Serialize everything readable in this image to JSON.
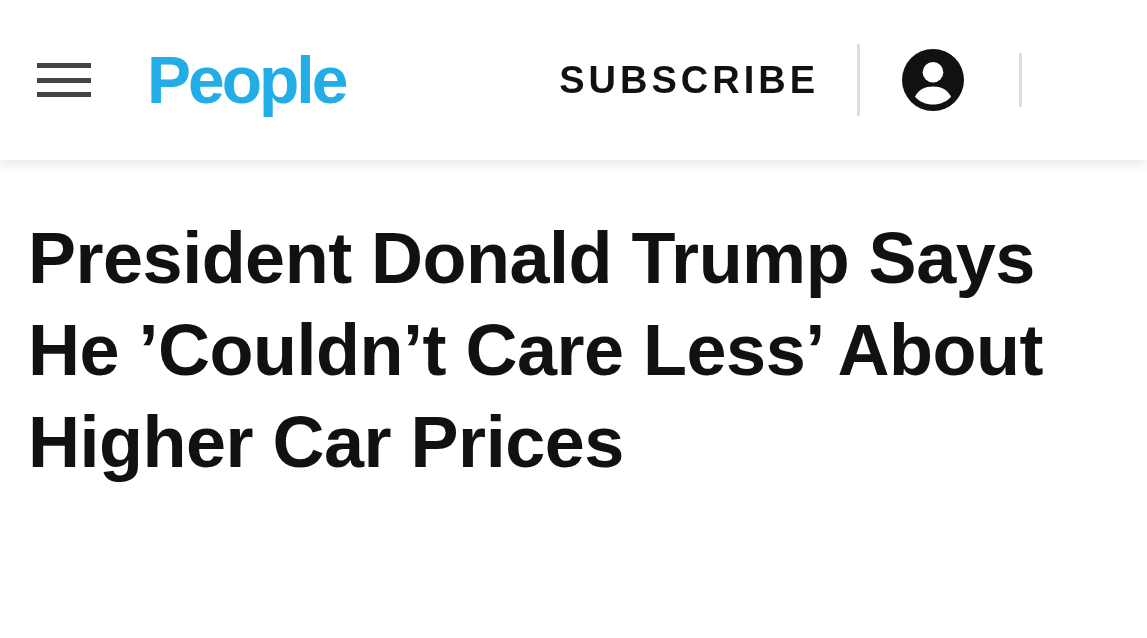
{
  "header": {
    "logo": "People",
    "subscribe": "SUBSCRIBE"
  },
  "article": {
    "headline": "President Donald Trump Says He ’Couldn’t Care Less’ About Higher Car Prices"
  }
}
